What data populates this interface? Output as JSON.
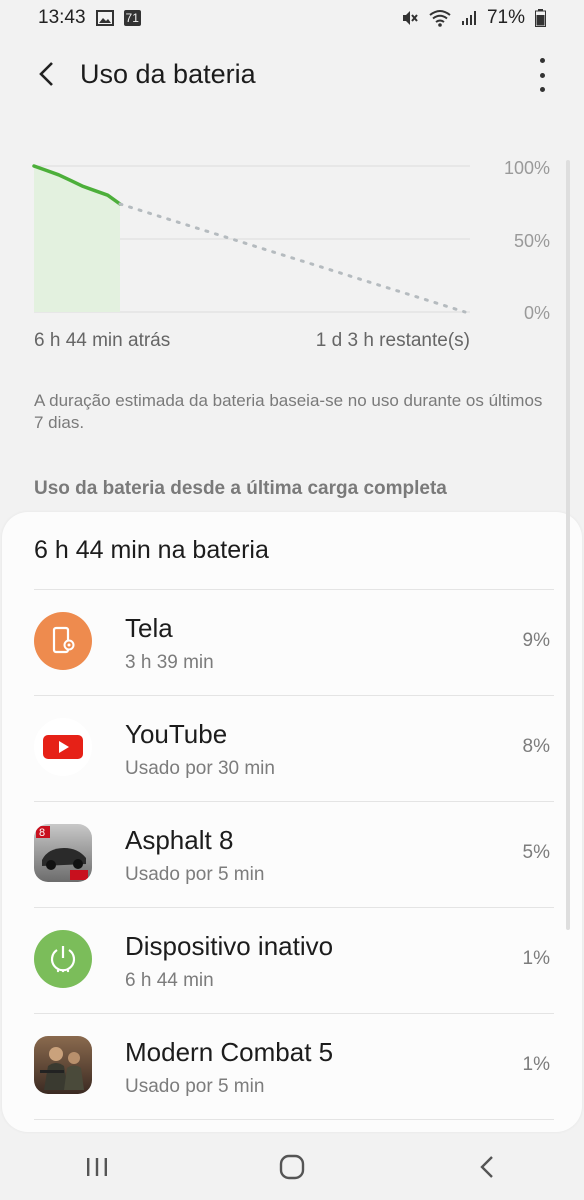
{
  "status_bar": {
    "time": "13:43",
    "notification_count": "71",
    "battery_percent": "71%"
  },
  "app_bar": {
    "title": "Uso da bateria"
  },
  "chart_data": {
    "type": "line",
    "series": [
      {
        "values": [
          100,
          97,
          94,
          90,
          86,
          83,
          80,
          74
        ]
      },
      {
        "values": [
          74,
          0
        ]
      }
    ],
    "y_ticks": [
      "100%",
      "50%",
      "0%"
    ],
    "x_labels": {
      "start": "6 h 44 min atrás",
      "end": "1 d 3 h restante(s)"
    },
    "ylim": [
      0,
      100
    ],
    "colors": {
      "history": "#4caf3a",
      "fill": "#e3f1df",
      "projection": "#b5bbbf",
      "grid": "#dcdcdc"
    }
  },
  "note": "A duração estimada da bateria baseia-se no uso durante os últimos 7 dias.",
  "section_title": "Uso da bateria desde a última carga completa",
  "card": {
    "header": "6 h 44 min na bateria",
    "items": [
      {
        "name": "Tela",
        "sub": "3 h 39 min",
        "pct": "9%",
        "icon": "screen-icon",
        "color": "#ee8b4e"
      },
      {
        "name": "YouTube",
        "sub": "Usado por 30 min",
        "pct": "8%",
        "icon": "youtube-icon",
        "color": "#e62117"
      },
      {
        "name": "Asphalt 8",
        "sub": "Usado por 5 min",
        "pct": "5%",
        "icon": "asphalt-icon",
        "color": "#3a3a3a"
      },
      {
        "name": "Dispositivo inativo",
        "sub": "6 h 44 min",
        "pct": "1%",
        "icon": "power-icon",
        "color": "#7bbd5a"
      },
      {
        "name": "Modern Combat 5",
        "sub": "Usado por 5 min",
        "pct": "1%",
        "icon": "modern-combat-icon",
        "color": "#6b4a3a"
      }
    ]
  }
}
